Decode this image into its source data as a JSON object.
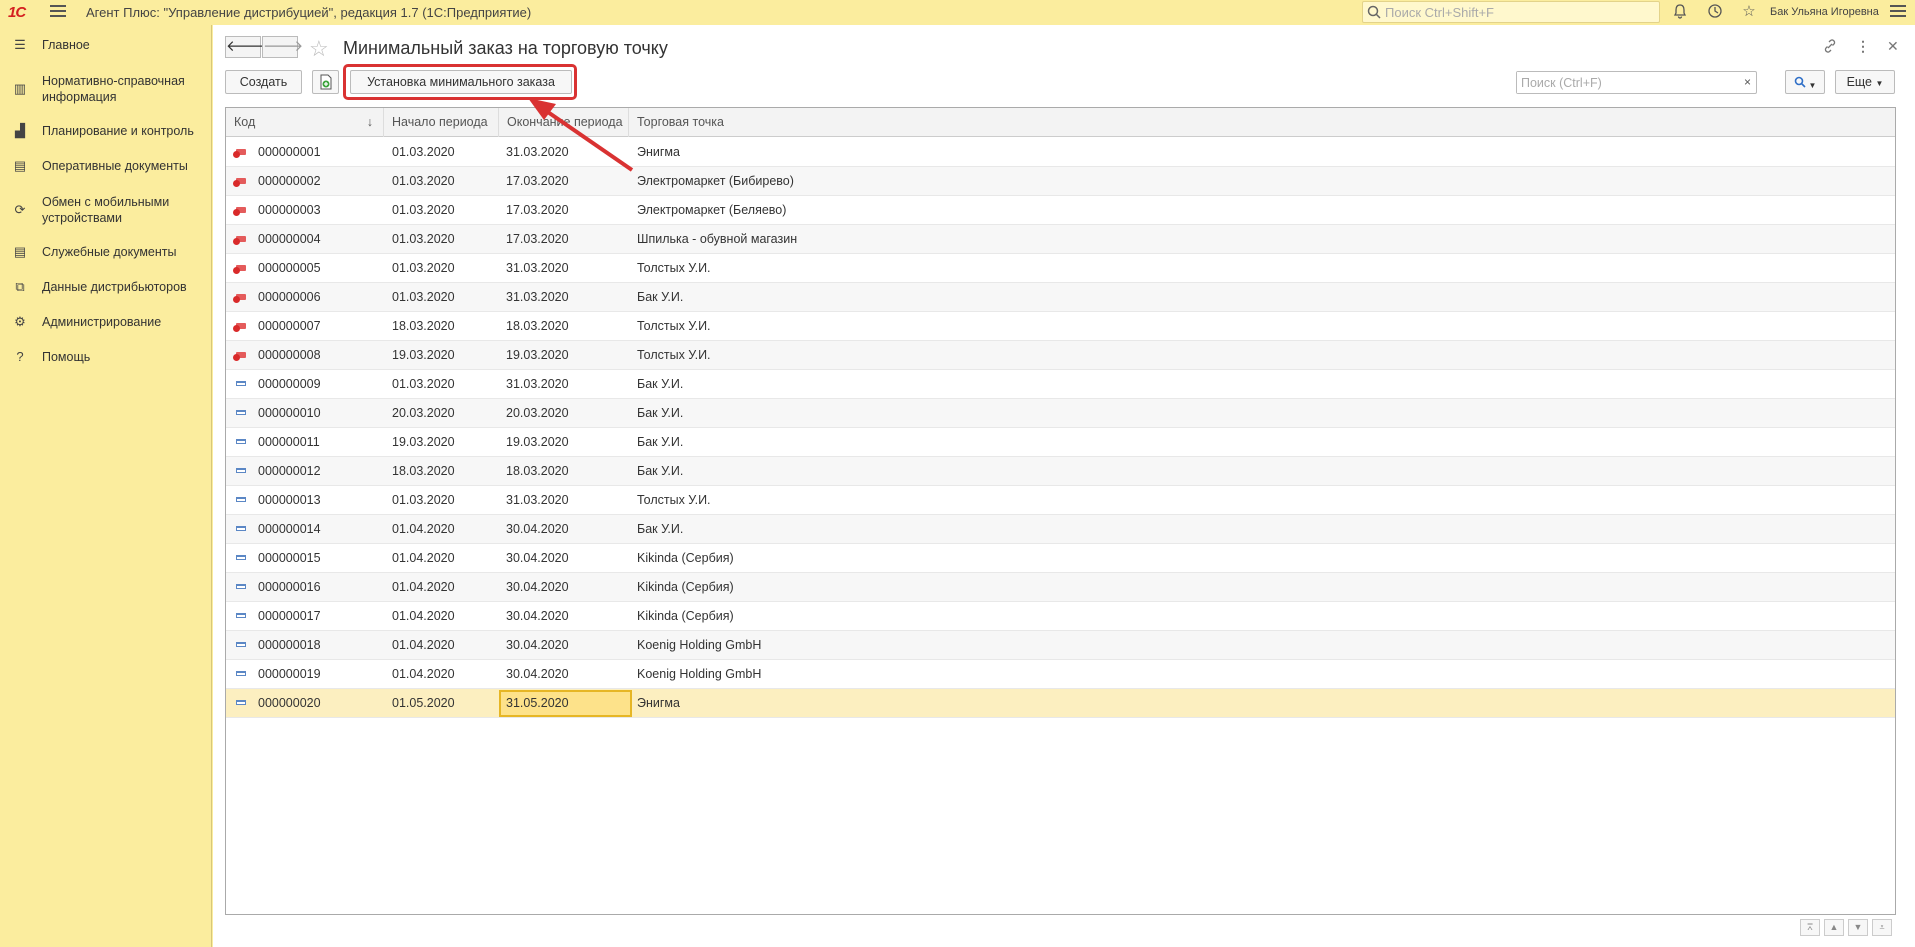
{
  "topbar": {
    "logo": "1С",
    "app_title": "Агент Плюс: \"Управление дистрибуцией\", редакция 1.7  (1С:Предприятие)",
    "search_placeholder": "Поиск Ctrl+Shift+F",
    "user_name": "Бак Ульяна Игоревна"
  },
  "sidebar": {
    "items": [
      {
        "label": "Главное",
        "icon": "menu-icon"
      },
      {
        "label": "Нормативно-справочная информация",
        "icon": "grid-icon"
      },
      {
        "label": "Планирование и контроль",
        "icon": "bar-chart-icon"
      },
      {
        "label": "Оперативные документы",
        "icon": "document-icon"
      },
      {
        "label": "Обмен с мобильными устройствами",
        "icon": "sync-icon"
      },
      {
        "label": "Служебные документы",
        "icon": "document-icon"
      },
      {
        "label": "Данные дистрибьюторов",
        "icon": "stack-icon"
      },
      {
        "label": "Администрирование",
        "icon": "gear-icon"
      },
      {
        "label": "Помощь",
        "icon": "question-icon"
      }
    ]
  },
  "form": {
    "title": "Минимальный заказ на торговую точку",
    "create_label": "Создать",
    "set_min_order_label": "Установка минимального заказа",
    "search_placeholder": "Поиск (Ctrl+F)",
    "clear_label": "×",
    "more_label": "Еще"
  },
  "table": {
    "columns": [
      "Код",
      "Начало периода",
      "Окончание периода",
      "Торговая точка"
    ],
    "sort_indicator": "↓",
    "rows": [
      {
        "code": "000000001",
        "start": "01.03.2020",
        "end": "31.03.2020",
        "outlet": "Энигма",
        "status": "deleted"
      },
      {
        "code": "000000002",
        "start": "01.03.2020",
        "end": "17.03.2020",
        "outlet": "Электромаркет (Бибирево)",
        "status": "deleted"
      },
      {
        "code": "000000003",
        "start": "01.03.2020",
        "end": "17.03.2020",
        "outlet": "Электромаркет (Беляево)",
        "status": "deleted"
      },
      {
        "code": "000000004",
        "start": "01.03.2020",
        "end": "17.03.2020",
        "outlet": "Шпилька - обувной магазин",
        "status": "deleted"
      },
      {
        "code": "000000005",
        "start": "01.03.2020",
        "end": "31.03.2020",
        "outlet": "Толстых У.И.",
        "status": "deleted"
      },
      {
        "code": "000000006",
        "start": "01.03.2020",
        "end": "31.03.2020",
        "outlet": "Бак У.И.",
        "status": "deleted"
      },
      {
        "code": "000000007",
        "start": "18.03.2020",
        "end": "18.03.2020",
        "outlet": "Толстых У.И.",
        "status": "deleted"
      },
      {
        "code": "000000008",
        "start": "19.03.2020",
        "end": "19.03.2020",
        "outlet": "Толстых У.И.",
        "status": "deleted"
      },
      {
        "code": "000000009",
        "start": "01.03.2020",
        "end": "31.03.2020",
        "outlet": "Бак У.И.",
        "status": "active"
      },
      {
        "code": "000000010",
        "start": "20.03.2020",
        "end": "20.03.2020",
        "outlet": "Бак У.И.",
        "status": "active"
      },
      {
        "code": "000000011",
        "start": "19.03.2020",
        "end": "19.03.2020",
        "outlet": "Бак У.И.",
        "status": "active"
      },
      {
        "code": "000000012",
        "start": "18.03.2020",
        "end": "18.03.2020",
        "outlet": "Бак У.И.",
        "status": "active"
      },
      {
        "code": "000000013",
        "start": "01.03.2020",
        "end": "31.03.2020",
        "outlet": "Толстых У.И.",
        "status": "active"
      },
      {
        "code": "000000014",
        "start": "01.04.2020",
        "end": "30.04.2020",
        "outlet": "Бак У.И.",
        "status": "active"
      },
      {
        "code": "000000015",
        "start": "01.04.2020",
        "end": "30.04.2020",
        "outlet": "Kikinda (Сербия)",
        "status": "active"
      },
      {
        "code": "000000016",
        "start": "01.04.2020",
        "end": "30.04.2020",
        "outlet": "Kikinda (Сербия)",
        "status": "active"
      },
      {
        "code": "000000017",
        "start": "01.04.2020",
        "end": "30.04.2020",
        "outlet": "Kikinda (Сербия)",
        "status": "active"
      },
      {
        "code": "000000018",
        "start": "01.04.2020",
        "end": "30.04.2020",
        "outlet": "Koenig Holding GmbH",
        "status": "active"
      },
      {
        "code": "000000019",
        "start": "01.04.2020",
        "end": "30.04.2020",
        "outlet": "Koenig Holding GmbH",
        "status": "active"
      },
      {
        "code": "000000020",
        "start": "01.05.2020",
        "end": "31.05.2020",
        "outlet": "Энигма",
        "status": "active",
        "selected": true
      }
    ]
  },
  "colors": {
    "accent_bg": "#fbed9e",
    "highlight": "#d93232",
    "selection": "#fcefc0"
  }
}
